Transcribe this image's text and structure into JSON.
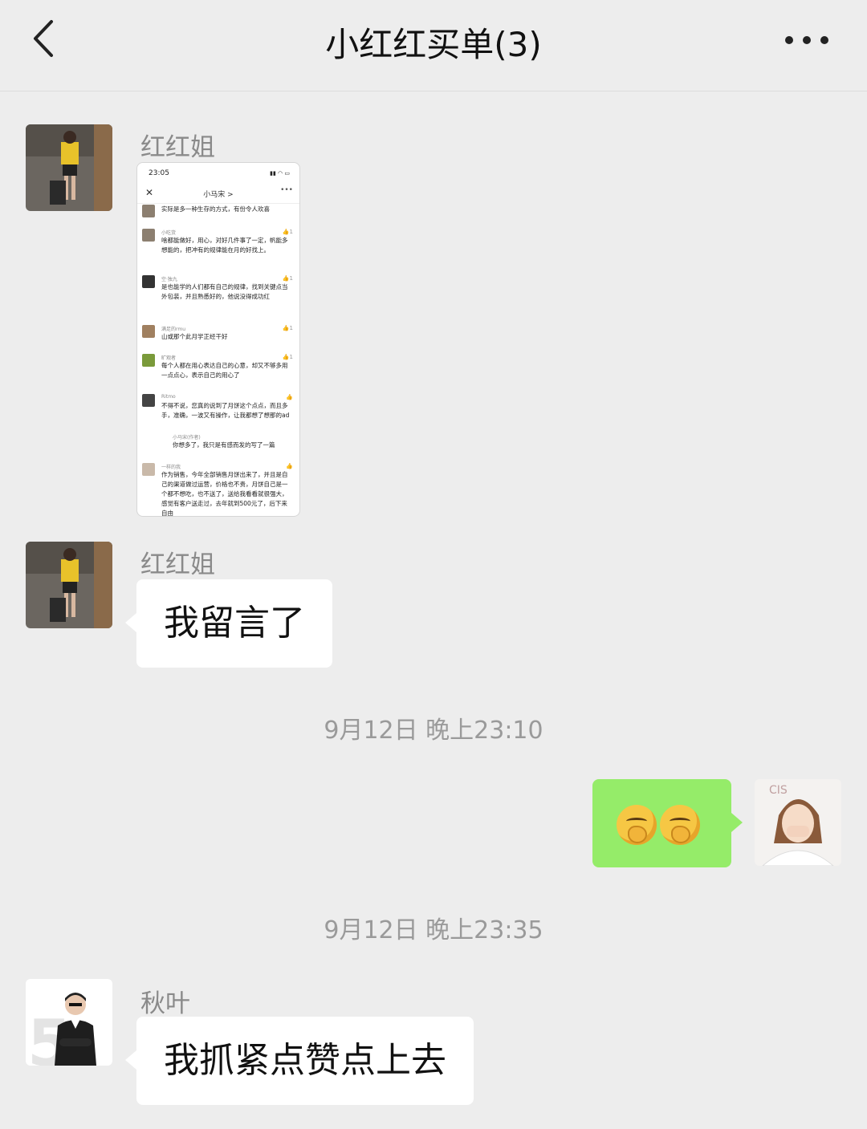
{
  "header": {
    "title": "小红红买单(3)",
    "back_icon": "chevron-left-icon",
    "more_icon": "more-icon"
  },
  "messages": [
    {
      "sender": "红红姐",
      "type": "image",
      "image": {
        "status_time": "23:05",
        "title": "小马宋 >",
        "comments": [
          {
            "name": "",
            "like": "",
            "text": "实际是多一种生存的方式，有份令人欢喜"
          },
          {
            "name": "小吃货",
            "like": "1",
            "text": "啥都能做好，用心，对好几件事了一定，帆能多想能的，把冲有的规律能在月的好找上。"
          },
          {
            "name": "空·独九",
            "like": "1",
            "text": "是也能学的人们都有自己的规律，找到关键点当外包装，并且熟悉好的，他说没得成功红"
          },
          {
            "name": "满足的rmu",
            "like": "1",
            "text": "山或那个此月学正经干好"
          },
          {
            "name": "旷观者",
            "like": "1",
            "text": "每个人都在用心表达自己的心意，却又不够多用一点点心，表示自己的用心了"
          },
          {
            "name": "Ritmo",
            "like": "",
            "text": "不得不说，您真的说到了月饼这个点点，而且多手，准确，一波又有操作，让我都想了想那的ad"
          },
          {
            "name": "小马宋(作者)",
            "like": "",
            "text": "你想多了，我只是有感而发的写了一篇"
          },
          {
            "name": "一样的我",
            "like": "",
            "text": "作为销售，今年全部销售月饼出来了，并且是自己的渠道做过运营，价格也不贵，月饼自己是一个都不想吃，也不送了，送给我看看就很强大，感觉有客户送走过，去年就到500元了，后下来自由"
          }
        ]
      }
    },
    {
      "sender": "红红姐",
      "type": "text",
      "text": "我留言了"
    },
    {
      "type": "time",
      "text": "9月12日 晚上23:10"
    },
    {
      "sender": "self",
      "type": "emoji",
      "emoji": [
        "hand-over-mouth-emoji",
        "hand-over-mouth-emoji"
      ]
    },
    {
      "type": "time",
      "text": "9月12日 晚上23:35"
    },
    {
      "sender": "秋叶",
      "type": "text",
      "text": "我抓紧点赞点上去"
    }
  ]
}
